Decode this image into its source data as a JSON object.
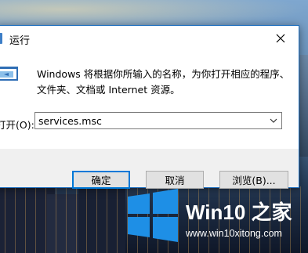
{
  "dialog": {
    "title": "运行",
    "description_line1": "Windows 将根据你所输入的名称，为你打开相应的程序、",
    "description_line2": "文件夹、文档或 Internet 资源。",
    "open_label": "打开(O):",
    "command_value": "services.msc"
  },
  "buttons": {
    "ok": "确定",
    "cancel": "取消",
    "browse": "浏览(B)..."
  },
  "watermark": {
    "brand": "Win10 之家",
    "url": "www.win10xitong.com"
  },
  "colors": {
    "accent": "#0078d7",
    "title_border": "#1e6fbf",
    "windows_logo": "#1e8fe6"
  }
}
